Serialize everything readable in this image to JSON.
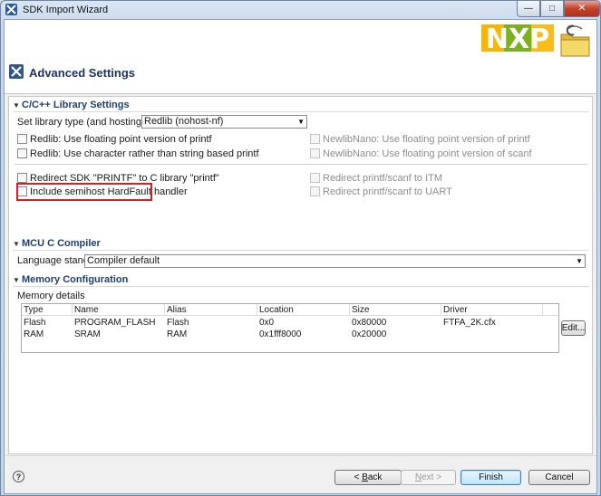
{
  "window": {
    "title": "SDK Import Wizard",
    "minimize": "—",
    "maximize": "□",
    "close": "✕"
  },
  "banner": {
    "title": "Advanced Settings",
    "logo_text": "NXP"
  },
  "library": {
    "section_title": "C/C++ Library Settings",
    "library_type_label": "Set library type (and hosting variant)",
    "library_type_value": "Redlib (nohost-nf)",
    "options_left": [
      {
        "label": "Redlib: Use floating point version of printf",
        "checked": false,
        "enabled": true
      },
      {
        "label": "Redlib: Use character rather than string based printf",
        "checked": false,
        "enabled": true
      },
      {
        "label": "Redirect SDK \"PRINTF\" to C library \"printf\"",
        "checked": false,
        "enabled": true
      },
      {
        "label": "Include semihost HardFault handler",
        "checked": false,
        "enabled": true
      }
    ],
    "options_right": [
      {
        "label": "NewlibNano: Use floating point version of printf",
        "checked": false,
        "enabled": false
      },
      {
        "label": "NewlibNano: Use floating point version of scanf",
        "checked": false,
        "enabled": false
      },
      {
        "label": "Redirect printf/scanf to ITM",
        "checked": false,
        "enabled": false
      },
      {
        "label": "Redirect printf/scanf to UART",
        "checked": false,
        "enabled": false
      }
    ]
  },
  "compiler": {
    "section_title": "MCU C Compiler",
    "language_label": "Language standard",
    "language_value": "Compiler default"
  },
  "memory": {
    "section_title": "Memory Configuration",
    "details_label": "Memory details",
    "columns": [
      "Type",
      "Name",
      "Alias",
      "Location",
      "Size",
      "Driver"
    ],
    "rows": [
      [
        "Flash",
        "PROGRAM_FLASH",
        "Flash",
        "0x0",
        "0x80000",
        "FTFA_2K.cfx"
      ],
      [
        "RAM",
        "SRAM",
        "RAM",
        "0x1fff8000",
        "0x20000",
        ""
      ]
    ],
    "edit_button": "Edit..."
  },
  "footer": {
    "help": "?",
    "back_prefix": "< ",
    "back_mnemonic": "B",
    "back_rest": "ack",
    "next_prefix": "",
    "next_mnemonic": "N",
    "next_rest": "ext >",
    "finish": "Finish",
    "cancel": "Cancel"
  }
}
